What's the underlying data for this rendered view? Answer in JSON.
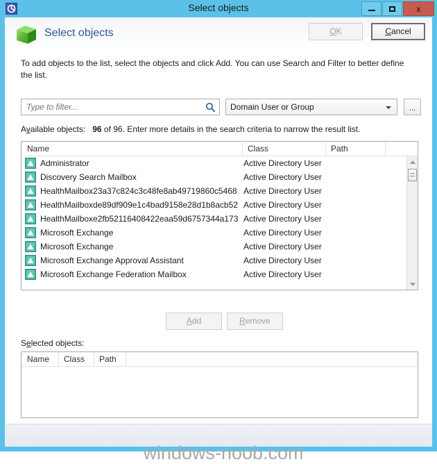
{
  "window": {
    "title": "Select objects",
    "icon": "select-objects-icon",
    "frame_color": "#5cc1e8",
    "controls": {
      "minimize": "minimize-icon",
      "maximize": "maximize-icon",
      "close_label": "x"
    }
  },
  "header": {
    "icon": "green-cube-icon",
    "title": "Select objects",
    "title_color": "#2b5797"
  },
  "intro_text": "To add objects to the list, select the objects and click Add. You can use Search and Filter to better define the list.",
  "filter": {
    "placeholder": "Type to filter...",
    "value": "",
    "search_icon": "magnifier-icon",
    "scope_selected": "Domain User or Group",
    "scope_options": [
      "Domain User or Group"
    ],
    "browse_label": "..."
  },
  "available": {
    "label_prefix": "A",
    "label_accel": "v",
    "label_suffix": "ailable objects:",
    "count_bold": "96",
    "count_rest": "of 96. Enter more details in the search criteria to narrow the result list.",
    "columns": [
      "Name",
      "Class",
      "Path"
    ],
    "rows": [
      {
        "icon": "ad-user-icon",
        "name": "Administrator",
        "class": "Active Directory User",
        "path": ""
      },
      {
        "icon": "ad-user-icon",
        "name": "Discovery Search Mailbox",
        "class": "Active Directory User",
        "path": ""
      },
      {
        "icon": "ad-user-icon",
        "name": "HealthMailbox23a37c824c3c48fe8ab49719860c5468",
        "class": "Active Directory User",
        "path": ""
      },
      {
        "icon": "ad-user-icon",
        "name": "HealthMailboxde89df909e1c4bad9158e28d1b8acb52",
        "class": "Active Directory User",
        "path": ""
      },
      {
        "icon": "ad-user-icon",
        "name": "HealthMailboxe2fb52116408422eaa59d6757344a173",
        "class": "Active Directory User",
        "path": ""
      },
      {
        "icon": "ad-user-icon",
        "name": "Microsoft Exchange",
        "class": "Active Directory User",
        "path": ""
      },
      {
        "icon": "ad-user-icon",
        "name": "Microsoft Exchange",
        "class": "Active Directory User",
        "path": ""
      },
      {
        "icon": "ad-user-icon",
        "name": "Microsoft Exchange Approval Assistant",
        "class": "Active Directory User",
        "path": ""
      },
      {
        "icon": "ad-user-icon",
        "name": "Microsoft Exchange Federation Mailbox",
        "class": "Active Directory User",
        "path": ""
      }
    ]
  },
  "transfer_buttons": {
    "add_accel": "A",
    "add_rest": "dd",
    "add_enabled": false,
    "remove_accel": "R",
    "remove_rest": "emove",
    "remove_enabled": false
  },
  "selected": {
    "label_prefix": "S",
    "label_accel": "e",
    "label_suffix": "lected objects:",
    "columns": [
      "Name",
      "Class",
      "Path"
    ],
    "rows": []
  },
  "footer": {
    "ok_accel": "O",
    "ok_rest": "K",
    "ok_enabled": false,
    "cancel_accel": "C",
    "cancel_rest": "ancel",
    "cancel_enabled": true
  },
  "watermark": "windows-noob.com"
}
